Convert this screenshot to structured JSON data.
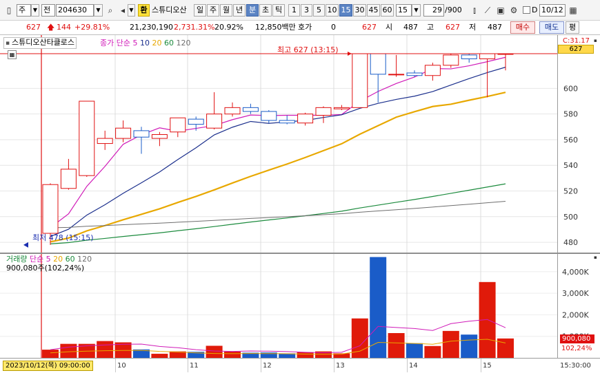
{
  "toolbar": {
    "period_type": "주",
    "market": "전",
    "code": "204630",
    "name_badge": "환",
    "stock_name": "스튜디오산",
    "periods": [
      "일",
      "주",
      "월",
      "년",
      "분",
      "초",
      "틱"
    ],
    "active_period": "분",
    "intervals": [
      "1",
      "3",
      "5",
      "10",
      "15",
      "30",
      "45",
      "60"
    ],
    "active_interval": "15",
    "interval_select": "15",
    "count_value": "29",
    "count_max": "/900",
    "date_checkbox_label": "D",
    "date_value": "10/12"
  },
  "quote": {
    "price": "627",
    "change": "144",
    "change_pct": "+29.81%",
    "volume": "21,230,190",
    "volume_ratio": "2,731.31%",
    "turnover": "20.92%",
    "amount": "12,850백만",
    "hoga_label": "호가",
    "hoga_value": "0",
    "hoga_price": "627",
    "open_label": "시",
    "open": "487",
    "high_label": "고",
    "high": "627",
    "low_label": "저",
    "low": "487",
    "buy_label": "매수",
    "sell_label": "매도",
    "more_label": "평"
  },
  "price_panel": {
    "name": "스튜디오산타클로스",
    "ma_label": "종가 단순",
    "ma_periods": [
      "5",
      "10",
      "20",
      "60",
      "120"
    ],
    "ma_colors": [
      "#d01ab8",
      "#1a2e8c",
      "#e8a800",
      "#1a8a3c",
      "#6d6d6d"
    ],
    "high_note": "최고 627 (13:15)",
    "low_note": "최저 478 (15:15)",
    "right_top_label": "C:31.17",
    "current_price_tag": "627",
    "ticks": [
      "600",
      "580",
      "560",
      "540",
      "520",
      "500",
      "480"
    ]
  },
  "volume_panel": {
    "title": "거래량",
    "ma_label": "단순",
    "ma_periods": [
      "5",
      "20",
      "60",
      "120"
    ],
    "value_text": "900,080주(102,24%)",
    "axis_ticks": [
      "4,000K",
      "3,000K",
      "2,000K",
      "1,000K"
    ],
    "tag_value": "900,080",
    "tag_pct": "102,24%"
  },
  "date_axis": {
    "cursor_label": "2023/10/12(목) 09:00:00",
    "labels": [
      "10",
      "11",
      "12",
      "13",
      "14",
      "15"
    ],
    "end_label": "15:30:00"
  },
  "colors": {
    "up": "#e01010",
    "down": "#1a5cc8",
    "highlight_tab": "#5b84c4",
    "badge": "#ffe23a"
  },
  "chart_data": {
    "type": "candlestick",
    "price_ylim": [
      472,
      634
    ],
    "volume_ylim": [
      0,
      4600
    ],
    "volume_unit": "K",
    "candles": [
      {
        "o": 487,
        "h": 526,
        "l": 478,
        "c": 525
      },
      {
        "o": 522,
        "h": 545,
        "l": 521,
        "c": 537
      },
      {
        "o": 532,
        "h": 590,
        "l": 531,
        "c": 590
      },
      {
        "o": 557,
        "h": 567,
        "l": 552,
        "c": 561
      },
      {
        "o": 561,
        "h": 575,
        "l": 558,
        "c": 569
      },
      {
        "o": 567,
        "h": 570,
        "l": 549,
        "c": 562
      },
      {
        "o": 561,
        "h": 566,
        "l": 555,
        "c": 564
      },
      {
        "o": 566,
        "h": 577,
        "l": 562,
        "c": 577
      },
      {
        "o": 576,
        "h": 578,
        "l": 567,
        "c": 572
      },
      {
        "o": 569,
        "h": 597,
        "l": 568,
        "c": 580
      },
      {
        "o": 580,
        "h": 589,
        "l": 578,
        "c": 585
      },
      {
        "o": 585,
        "h": 588,
        "l": 580,
        "c": 582
      },
      {
        "o": 582,
        "h": 583,
        "l": 573,
        "c": 575
      },
      {
        "o": 575,
        "h": 579,
        "l": 572,
        "c": 573
      },
      {
        "o": 573,
        "h": 581,
        "l": 571,
        "c": 580
      },
      {
        "o": 579,
        "h": 586,
        "l": 573,
        "c": 585
      },
      {
        "o": 584,
        "h": 587,
        "l": 583,
        "c": 585
      },
      {
        "o": 585,
        "h": 627,
        "l": 585,
        "c": 627
      },
      {
        "o": 627,
        "h": 627,
        "l": 589,
        "c": 611
      },
      {
        "o": 611,
        "h": 626,
        "l": 609,
        "c": 611
      },
      {
        "o": 612,
        "h": 614,
        "l": 609,
        "c": 610
      },
      {
        "o": 610,
        "h": 620,
        "l": 606,
        "c": 618
      },
      {
        "o": 618,
        "h": 627,
        "l": 616,
        "c": 626
      },
      {
        "o": 626,
        "h": 627,
        "l": 620,
        "c": 623
      },
      {
        "o": 623,
        "h": 627,
        "l": 593,
        "c": 627
      },
      {
        "o": 627,
        "h": 627,
        "l": 614,
        "c": 627
      }
    ],
    "volume": [
      380,
      650,
      650,
      780,
      720,
      390,
      190,
      300,
      280,
      560,
      290,
      240,
      250,
      210,
      260,
      300,
      210,
      1830,
      4680,
      1150,
      680,
      550,
      1250,
      1080,
      3520,
      900
    ],
    "ma5_vol": [
      380,
      500,
      560,
      600,
      630,
      640,
      530,
      470,
      380,
      320,
      300,
      320,
      310,
      290,
      260,
      240,
      260,
      560,
      1460,
      1410,
      1360,
      1270,
      1590,
      1700,
      1780,
      1400
    ]
  }
}
